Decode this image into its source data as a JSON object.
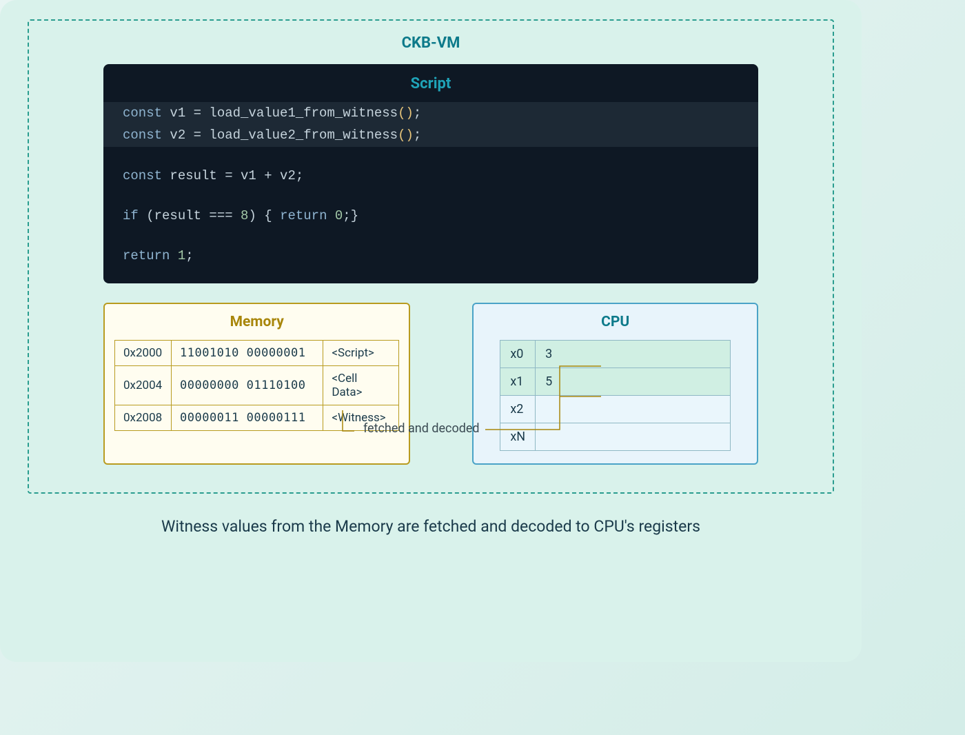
{
  "vm_title": "CKB-VM",
  "script": {
    "title": "Script",
    "lines": {
      "l1_kw": "const",
      "l1_rest": " v1 = load_value1_from_witness",
      "l2_kw": "const",
      "l2_rest": " v2 = load_value2_from_witness",
      "l3_kw": "const",
      "l3_rest": " result = v1 + v2;",
      "l4_if": "if",
      "l4_cond": " (result === ",
      "l4_num": "8",
      "l4_after": ") { ",
      "l4_ret": "return",
      "l4_retval": " 0",
      "l4_end": ";}",
      "l5_ret": "return",
      "l5_val": " 1",
      "l5_end": ";"
    },
    "paren_open": "()",
    "semicolon": ";"
  },
  "memory": {
    "title": "Memory",
    "rows": [
      {
        "addr": "0x2000",
        "bin": "11001010 00000001",
        "tag": "<Script>"
      },
      {
        "addr": "0x2004",
        "bin": "00000000 01110100",
        "tag": "<Cell Data>"
      },
      {
        "addr": "0x2008",
        "bin": "00000011 00000111",
        "tag": "<Witness>"
      }
    ]
  },
  "cpu": {
    "title": "CPU",
    "rows": [
      {
        "reg": "x0",
        "val": "3",
        "hl": true
      },
      {
        "reg": "x1",
        "val": "5",
        "hl": true
      },
      {
        "reg": "x2",
        "val": "",
        "hl": false
      },
      {
        "reg": "xN",
        "val": "",
        "hl": false
      }
    ]
  },
  "fetch_label": "fetched and decoded",
  "caption": "Witness values from the Memory are fetched and decoded to CPU's registers"
}
